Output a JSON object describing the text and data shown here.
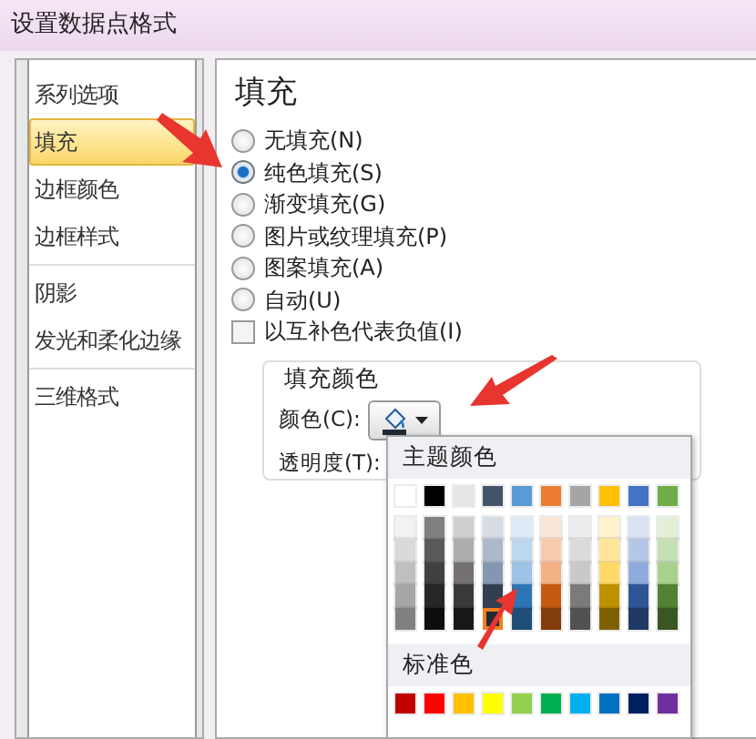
{
  "window": {
    "title": "设置数据点格式"
  },
  "sidebar": {
    "items": [
      {
        "label": "系列选项",
        "selected": false
      },
      {
        "label": "填充",
        "selected": true
      },
      {
        "label": "边框颜色",
        "selected": false
      },
      {
        "label": "边框样式",
        "selected": false
      },
      {
        "label": "阴影",
        "selected": false
      },
      {
        "label": "发光和柔化边缘",
        "selected": false
      },
      {
        "label": "三维格式",
        "selected": false
      }
    ]
  },
  "panel": {
    "heading": "填充",
    "options": [
      {
        "kind": "radio",
        "label": "无填充(N)",
        "selected": false
      },
      {
        "kind": "radio",
        "label": "纯色填充(S)",
        "selected": true
      },
      {
        "kind": "radio",
        "label": "渐变填充(G)",
        "selected": false
      },
      {
        "kind": "radio",
        "label": "图片或纹理填充(P)",
        "selected": false
      },
      {
        "kind": "radio",
        "label": "图案填充(A)",
        "selected": false
      },
      {
        "kind": "radio",
        "label": "自动(U)",
        "selected": false
      },
      {
        "kind": "checkbox",
        "label": "以互补色代表负值(I)",
        "checked": false
      }
    ],
    "fill_color": {
      "legend": "填充颜色",
      "color_label": "颜色(C):",
      "transparency_label": "透明度(T):"
    }
  },
  "color_menu": {
    "theme_label": "主题颜色",
    "theme_top": [
      {
        "color": "#ffffff",
        "selected": false
      },
      {
        "color": "#000000",
        "selected": false
      },
      {
        "color": "#e7e6e6",
        "selected": false
      },
      {
        "color": "#44546a",
        "selected": false
      },
      {
        "color": "#5b9bd5",
        "selected": false
      },
      {
        "color": "#ed7d31",
        "selected": false
      },
      {
        "color": "#a5a5a5",
        "selected": false
      },
      {
        "color": "#ffc000",
        "selected": false
      },
      {
        "color": "#4472c4",
        "selected": false
      },
      {
        "color": "#70ad47",
        "selected": false
      }
    ],
    "theme_shades": [
      [
        {
          "color": "#f2f2f2",
          "selected": false
        },
        {
          "color": "#808080",
          "selected": false
        },
        {
          "color": "#d0cece",
          "selected": false
        },
        {
          "color": "#d6dce4",
          "selected": false
        },
        {
          "color": "#deebf6",
          "selected": false
        },
        {
          "color": "#fbe5d5",
          "selected": false
        },
        {
          "color": "#ededed",
          "selected": false
        },
        {
          "color": "#fff2cc",
          "selected": false
        },
        {
          "color": "#dae3f3",
          "selected": false
        },
        {
          "color": "#e2f0d9",
          "selected": false
        }
      ],
      [
        {
          "color": "#d9d9d9",
          "selected": false
        },
        {
          "color": "#595959",
          "selected": false
        },
        {
          "color": "#aeabab",
          "selected": false
        },
        {
          "color": "#adb9ca",
          "selected": false
        },
        {
          "color": "#bdd7ee",
          "selected": false
        },
        {
          "color": "#f7cbac",
          "selected": false
        },
        {
          "color": "#dbdbdb",
          "selected": false
        },
        {
          "color": "#ffe699",
          "selected": false
        },
        {
          "color": "#b4c7e7",
          "selected": false
        },
        {
          "color": "#c5e0b4",
          "selected": false
        }
      ],
      [
        {
          "color": "#bfbfbf",
          "selected": false
        },
        {
          "color": "#404040",
          "selected": false
        },
        {
          "color": "#757171",
          "selected": false
        },
        {
          "color": "#8497b0",
          "selected": false
        },
        {
          "color": "#9dc3e6",
          "selected": false
        },
        {
          "color": "#f4b183",
          "selected": false
        },
        {
          "color": "#c9c9c9",
          "selected": false
        },
        {
          "color": "#ffd966",
          "selected": false
        },
        {
          "color": "#8faadc",
          "selected": false
        },
        {
          "color": "#a9d18e",
          "selected": false
        }
      ],
      [
        {
          "color": "#a6a6a6",
          "selected": false
        },
        {
          "color": "#262626",
          "selected": false
        },
        {
          "color": "#3b3838",
          "selected": false
        },
        {
          "color": "#333f4f",
          "selected": false
        },
        {
          "color": "#2e75b5",
          "selected": false
        },
        {
          "color": "#c55a11",
          "selected": false
        },
        {
          "color": "#7b7b7b",
          "selected": false
        },
        {
          "color": "#bf9000",
          "selected": false
        },
        {
          "color": "#2f5597",
          "selected": false
        },
        {
          "color": "#538135",
          "selected": false
        }
      ],
      [
        {
          "color": "#808080",
          "selected": false
        },
        {
          "color": "#0d0d0d",
          "selected": false
        },
        {
          "color": "#181717",
          "selected": false
        },
        {
          "color": "#222a35",
          "selected": true
        },
        {
          "color": "#1f4e79",
          "selected": false
        },
        {
          "color": "#833c0b",
          "selected": false
        },
        {
          "color": "#525252",
          "selected": false
        },
        {
          "color": "#7f6000",
          "selected": false
        },
        {
          "color": "#203864",
          "selected": false
        },
        {
          "color": "#385723",
          "selected": false
        }
      ]
    ],
    "standard_label": "标准色",
    "standard": [
      {
        "color": "#c00000",
        "selected": false
      },
      {
        "color": "#ff0000",
        "selected": false
      },
      {
        "color": "#ffc000",
        "selected": false
      },
      {
        "color": "#ffff00",
        "selected": false
      },
      {
        "color": "#92d050",
        "selected": false
      },
      {
        "color": "#00b050",
        "selected": false
      },
      {
        "color": "#00b0f0",
        "selected": false
      },
      {
        "color": "#0070c0",
        "selected": false
      },
      {
        "color": "#002060",
        "selected": false
      },
      {
        "color": "#7030a0",
        "selected": false
      }
    ]
  }
}
